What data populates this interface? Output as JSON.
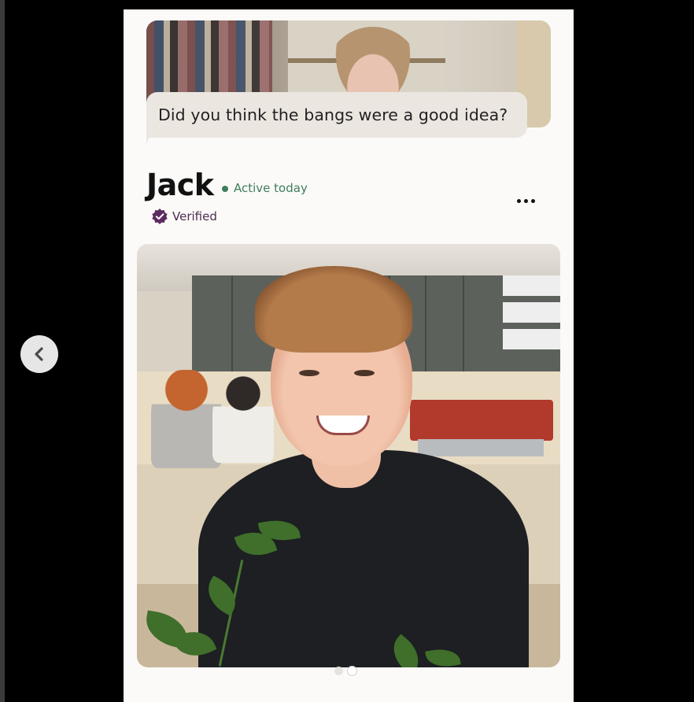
{
  "prompt": {
    "text": "Did you think the bangs were a good idea?"
  },
  "profile": {
    "name": "Jack",
    "status": "Active today",
    "verified_label": "Verified"
  },
  "photo_carousel": {
    "count": 2,
    "current": 2
  },
  "icons": {
    "prev": "chevron-left-icon",
    "more": "more-horizontal-icon",
    "verified": "verified-badge-icon"
  },
  "colors": {
    "active_green": "#3f7d5b",
    "verified_purple": "#5b2a5e",
    "bubble": "#ece6e1"
  }
}
